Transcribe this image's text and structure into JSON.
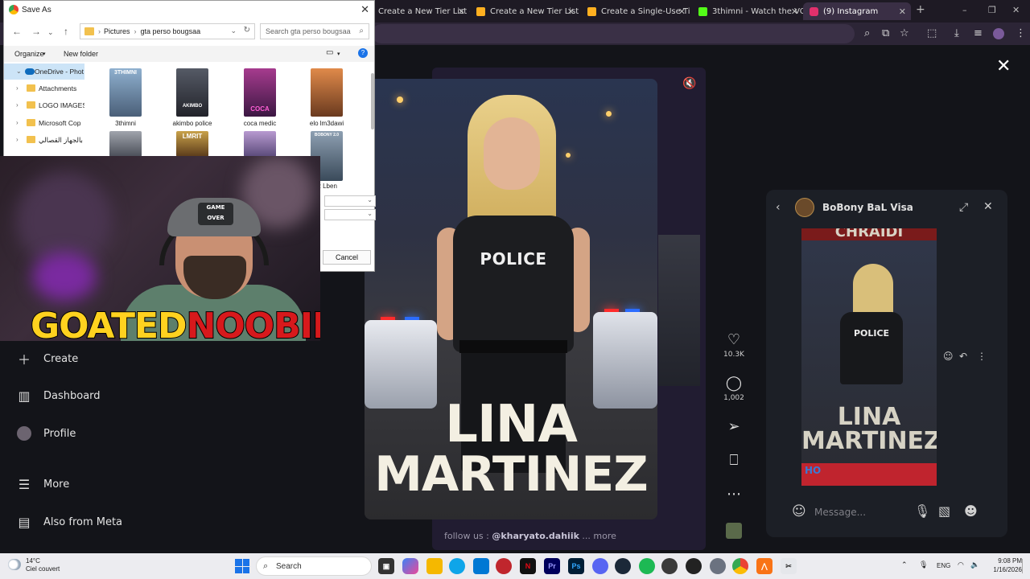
{
  "browser": {
    "tabs": [
      {
        "label": "Create a New Tier List - Ti",
        "favicon_color": "#ffb020"
      },
      {
        "label": "Create a New Tier List - Ti",
        "favicon_color": "#ffb020"
      },
      {
        "label": "Create a Single-Use Tier L",
        "favicon_color": "#ffb020"
      },
      {
        "label": "3thimni - Watch the VOD",
        "favicon_color": "#53fc18"
      },
      {
        "label": "(9) Instagram",
        "favicon_color": "#e1306c"
      }
    ],
    "new_tab": "+",
    "window_controls": [
      "–",
      "❐",
      "✕"
    ]
  },
  "dialog": {
    "title": "Save As",
    "path": [
      "Pictures",
      "gta perso bougsaa"
    ],
    "search_placeholder": "Search gta perso bougsaa",
    "organize": "Organize",
    "new_folder": "New folder",
    "sidebar": [
      {
        "label": "OneDrive - Phot",
        "selected": true
      },
      {
        "label": "Attachments"
      },
      {
        "label": "LOGO IMAGES"
      },
      {
        "label": "Microsoft Cop"
      },
      {
        "label": "بالجهاز القصالي"
      }
    ],
    "files": [
      {
        "name": "3thimni",
        "title_text": "3THIMNI",
        "color": "#6a86a8"
      },
      {
        "name": "akimbo police",
        "title_text": "AKIMBO",
        "color": "#3a3a44"
      },
      {
        "name": "coca medic",
        "title_text": "COCA",
        "color": "#7a2a6a"
      },
      {
        "name": "elo lm3dawi",
        "title_text": "",
        "color": "#c0713a"
      },
      {
        "name": "",
        "title_text": "",
        "color": "#4a4e58"
      },
      {
        "name": "",
        "title_text": "LMRIT",
        "color": "#8a6a2a"
      },
      {
        "name": "",
        "title_text": "",
        "color": "#6a5a8a"
      },
      {
        "name": "R Lben",
        "title_text": "BOBONY 2.0",
        "color": "#5a6a7a"
      }
    ],
    "cancel": "Cancel"
  },
  "webcam": {
    "cap_text": "GAME OVER",
    "logo_goated": "GOATED",
    "logo_noobie": "NOOBIE"
  },
  "instagram_nav": [
    {
      "label": "Create",
      "icon": "plus-icon"
    },
    {
      "label": "Dashboard",
      "icon": "chart-icon"
    },
    {
      "label": "Profile",
      "icon": "avatar-icon"
    },
    {
      "label": "More",
      "icon": "menu-icon"
    },
    {
      "label": "Also from Meta",
      "icon": "meta-icon"
    }
  ],
  "post": {
    "badge": "POLICE",
    "name_line1": "LINA",
    "name_line2": "MARTINEZ",
    "caption_prefix": "follow us :",
    "caption_handle": "@kharyato.dahiik",
    "caption_more": "... more",
    "likes": "10.3K",
    "comments": "1,002"
  },
  "dm": {
    "name": "BoBony BaL Visa",
    "image_top_text": "CHRAIDI",
    "image_badge": "POLICE",
    "image_name_line1": "LINA",
    "image_name_line2": "MARTINEZ",
    "image_bottom_text": "HO",
    "message_placeholder": "Message..."
  },
  "taskbar": {
    "temperature": "14°C",
    "weather": "Ciel couvert",
    "search": "Search",
    "language": "ENG",
    "time": "9:08 PM",
    "date": "1/16/2026"
  }
}
